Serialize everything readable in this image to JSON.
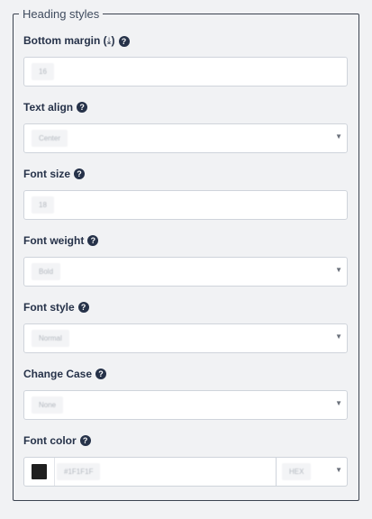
{
  "section": {
    "legend": "Heading styles"
  },
  "fields": [
    {
      "label": "Bottom margin (↓)",
      "type": "input",
      "value": "16"
    },
    {
      "label": "Text align",
      "type": "select",
      "value": "Center"
    },
    {
      "label": "Font size",
      "type": "input",
      "value": "18"
    },
    {
      "label": "Font weight",
      "type": "select",
      "value": "Bold"
    },
    {
      "label": "Font style",
      "type": "select",
      "value": "Normal"
    },
    {
      "label": "Change Case",
      "type": "select",
      "value": "None"
    }
  ],
  "font_color": {
    "label": "Font color",
    "value": "#1F1F1F",
    "swatch": "#1f1f1f",
    "format": "HEX"
  },
  "icons": {
    "help": "question-circle-icon",
    "caret": "chevron-down-icon",
    "arrow": "arrow-down-circle-icon"
  },
  "glyphs": {
    "help": "?",
    "caret": "▼"
  }
}
